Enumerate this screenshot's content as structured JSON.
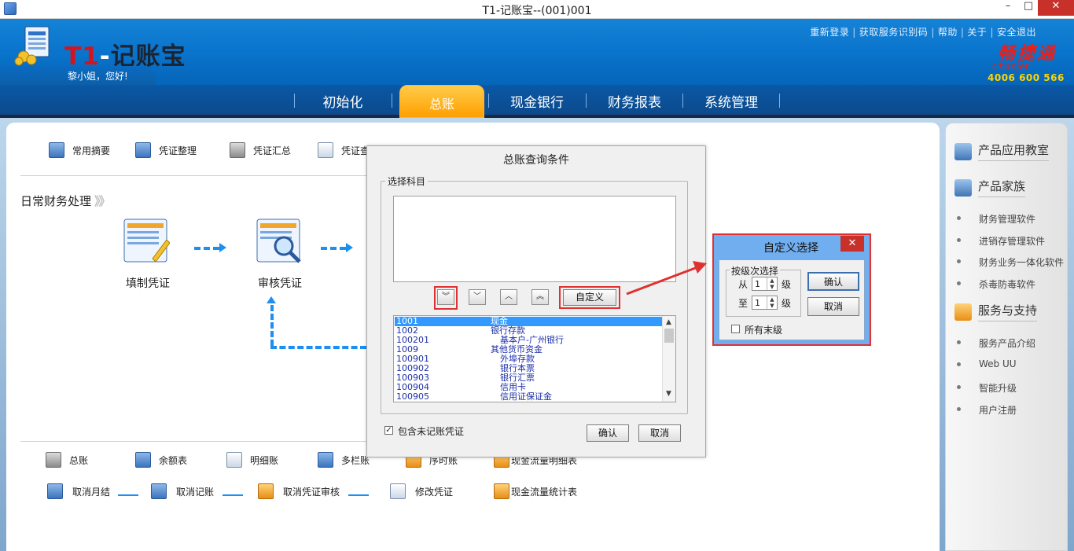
{
  "window": {
    "title": "T1-记账宝--(001)001",
    "minimize": "–",
    "maximize": "□",
    "close": "✕"
  },
  "header": {
    "logo_t1": "T1",
    "logo_dash": "-",
    "logo_cn": "记账宝",
    "greeting": "黎小姐，您好!",
    "links": [
      "重新登录",
      "获取服务识别码",
      "帮助",
      "关于",
      "安全退出"
    ],
    "brand_cn": "畅捷通",
    "brand_en": "Chanjet",
    "brand_phone": "4006 600 566"
  },
  "nav": {
    "items": [
      "初始化",
      "总账",
      "现金银行",
      "财务报表",
      "系统管理"
    ],
    "active": "总账",
    "active_color": "#ff9f00"
  },
  "toolbar_top": [
    {
      "label": "常用摘要",
      "icon": "calendar-icon"
    },
    {
      "label": "凭证整理",
      "icon": "vouchers-icon"
    },
    {
      "label": "凭证汇总",
      "icon": "summary-icon"
    },
    {
      "label": "凭证查",
      "icon": "voucher-search-icon"
    }
  ],
  "section": {
    "title": "日常财务处理",
    "arrows": "》》",
    "flow": [
      {
        "label": "填制凭证",
        "icon": "fill-voucher-icon"
      },
      {
        "label": "审核凭证",
        "icon": "review-voucher-icon"
      }
    ]
  },
  "toolbar_bottom_row1": [
    {
      "label": "总账",
      "icon": "ledger-icon"
    },
    {
      "label": "余额表",
      "icon": "balance-icon"
    },
    {
      "label": "明细账",
      "icon": "detail-ledger-icon"
    },
    {
      "label": "多栏账",
      "icon": "multi-column-icon"
    },
    {
      "label": "序时账",
      "icon": "chronological-icon"
    },
    {
      "label": "现金流量明细表",
      "icon": "cashflow-detail-icon"
    }
  ],
  "toolbar_bottom_row2": [
    {
      "label": "取消月结",
      "icon": "cancel-monthend-icon"
    },
    {
      "label": "取消记账",
      "icon": "cancel-posting-icon"
    },
    {
      "label": "取消凭证审核",
      "icon": "cancel-review-icon"
    },
    {
      "label": "修改凭证",
      "icon": "edit-voucher-icon"
    },
    {
      "label": "现金流量统计表",
      "icon": "cashflow-stats-icon"
    }
  ],
  "dialog": {
    "title": "总账查询条件",
    "group_label": "选择科目",
    "btn_all_down": "︾",
    "btn_down": "﹀",
    "btn_up": "︿",
    "btn_all_up": "︽",
    "btn_custom": "自定义",
    "accounts": [
      {
        "code": "1001",
        "name": "现金",
        "indent": 0,
        "selected": true
      },
      {
        "code": "1002",
        "name": "银行存款",
        "indent": 0
      },
      {
        "code": "100201",
        "name": "基本户-广州银行",
        "indent": 1
      },
      {
        "code": "1009",
        "name": "其他货币资金",
        "indent": 0
      },
      {
        "code": "100901",
        "name": "外埠存款",
        "indent": 1
      },
      {
        "code": "100902",
        "name": "银行本票",
        "indent": 1
      },
      {
        "code": "100903",
        "name": "银行汇票",
        "indent": 1
      },
      {
        "code": "100904",
        "name": "信用卡",
        "indent": 1
      },
      {
        "code": "100905",
        "name": "信用证保证金",
        "indent": 1
      }
    ],
    "include_unposted": "包含未记账凭证",
    "include_unposted_checked": true,
    "ok": "确认",
    "cancel": "取消"
  },
  "custom_dialog": {
    "title": "自定义选择",
    "close": "✕",
    "group_label": "按级次选择",
    "from_label": "从",
    "to_label": "至",
    "from_value": "1",
    "to_value": "1",
    "unit": "级",
    "ok": "确认",
    "cancel": "取消",
    "all_leaf": "所有末级",
    "all_leaf_checked": false
  },
  "sidebar": {
    "section1": "产品应用教室",
    "section2": "产品家族",
    "family": [
      "财务管理软件",
      "进销存管理软件",
      "财务业务一体化软件",
      "杀毒防毒软件"
    ],
    "section3": "服务与支持",
    "support": [
      "服务产品介绍",
      "Web UU",
      "智能升级",
      "用户注册"
    ]
  }
}
